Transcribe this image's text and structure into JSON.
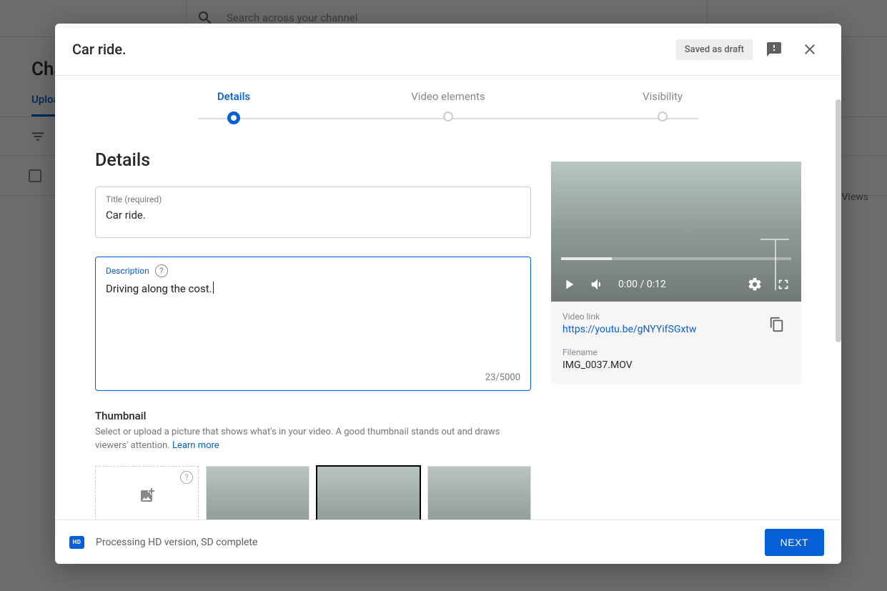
{
  "background": {
    "search_placeholder": "Search across your channel",
    "heading": "Channel content",
    "tab_uploads": "Uploads",
    "views_header": "Views"
  },
  "dialog": {
    "title": "Car ride.",
    "draft_badge": "Saved as draft"
  },
  "stepper": {
    "step1": "Details",
    "step2": "Video elements",
    "step3": "Visibility"
  },
  "details": {
    "heading": "Details",
    "title_field_label": "Title (required)",
    "title_value": "Car ride.",
    "desc_label": "Description",
    "desc_value": "Driving along the cost.",
    "desc_counter": "23/5000",
    "thumb_heading": "Thumbnail",
    "thumb_sub": "Select or upload a picture that shows what's in your video. A good thumbnail stands out and draws viewers' attention. ",
    "learn_more": "Learn more"
  },
  "preview": {
    "time": "0:00 / 0:12",
    "link_label": "Video link",
    "link_value": "https://youtu.be/gNYYifSGxtw",
    "filename_label": "Filename",
    "filename_value": "IMG_0037.MOV"
  },
  "footer": {
    "hd_label": "HD",
    "status": "Processing HD version, SD complete",
    "next": "NEXT"
  }
}
